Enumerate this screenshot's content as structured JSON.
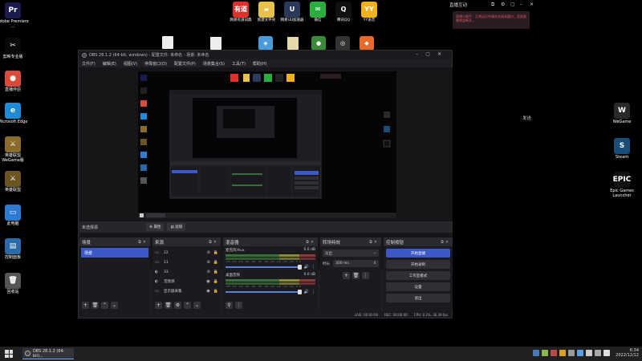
{
  "desktop_left": [
    {
      "label": "Adobe Premiere ...",
      "glyph": "Pr",
      "color": "#1c1b4e"
    },
    {
      "label": "剪映专业版",
      "glyph": "✂",
      "color": "#0a0a0a"
    },
    {
      "label": "直播伴侣",
      "glyph": "●",
      "color": "#d94a3a"
    },
    {
      "label": "Microsoft Edge",
      "glyph": "e",
      "color": "#1e8bd6"
    },
    {
      "label": "英雄联盟 WeGame版",
      "glyph": "⚔",
      "color": "#8a6b2b"
    },
    {
      "label": "英雄联盟",
      "glyph": "⚔",
      "color": "#6b5420"
    },
    {
      "label": "此电脑",
      "glyph": "▭",
      "color": "#2c7bd4"
    },
    {
      "label": "控制面板",
      "glyph": "▤",
      "color": "#2a6aa8"
    },
    {
      "label": "回收站",
      "glyph": "🗑",
      "color": "#555"
    }
  ],
  "desktop_top": [
    {
      "label": "网易有道词典",
      "glyph": "有道",
      "color": "#e0302c"
    },
    {
      "label": "新建文件夹",
      "glyph": "▰",
      "color": "#e8c04a"
    },
    {
      "label": "网易UU加速器",
      "glyph": "U",
      "color": "#2b3a5a"
    },
    {
      "label": "微信",
      "glyph": "✉",
      "color": "#2aae3e"
    },
    {
      "label": "腾讯QQ",
      "glyph": "Q",
      "color": "#111"
    },
    {
      "label": "YY语音",
      "glyph": "YY",
      "color": "#f0b020"
    }
  ],
  "desktop_right": [
    {
      "label": "WeGame",
      "glyph": "W",
      "color": "#2a2a2a"
    },
    {
      "label": "Steam",
      "glyph": "S",
      "color": "#1b4d7a"
    },
    {
      "label": "Epic Games Launcher",
      "glyph": "EPIC",
      "color": "#111"
    }
  ],
  "live_panel": {
    "title": "直播互动",
    "note": "直播小助手：正常运行中请勿关闭本窗口，否则直播将会断开...",
    "send": "发送"
  },
  "obs": {
    "title": "OBS 28.1.2 (64-bit, windows) - 配置文件: 未命名 - 场景: 未命名",
    "menu": [
      "文件(F)",
      "编辑(E)",
      "视图(V)",
      "停靠窗口(D)",
      "配置文件(P)",
      "场景集合(S)",
      "工具(T)",
      "帮助(H)"
    ],
    "source_bar": {
      "label": "未选择源",
      "props": "⚙ 属性",
      "filters": "▤ 滤镜"
    },
    "scenes": {
      "title": "场景",
      "items": [
        "场景"
      ]
    },
    "sources": {
      "title": "来源",
      "items": [
        {
          "icon": "▭",
          "name": "22",
          "state": "⊘"
        },
        {
          "icon": "▭",
          "name": "11",
          "state": "⊘"
        },
        {
          "icon": "◐",
          "name": "33",
          "state": "⊘"
        },
        {
          "icon": "◐",
          "name": "音频源",
          "state": "◉"
        },
        {
          "icon": "▭",
          "name": "显示器采集",
          "state": "◉"
        }
      ]
    },
    "mixer": {
      "title": "混音器",
      "channels": [
        {
          "name": "麦克风/Aux",
          "db": "0.0 dB"
        },
        {
          "name": "桌面音频",
          "db": "0.0 dB"
        }
      ],
      "ticks": "-60 -55 -50 -45 -40 -35 -30 -25 -20 -15 -10 -5 0"
    },
    "transitions": {
      "title": "转场特效",
      "type": "淡出",
      "duration_label": "时长",
      "duration": "300 ms"
    },
    "controls": {
      "title": "控制按钮",
      "buttons": [
        "开始直播",
        "开始录制",
        "工作室模式",
        "设置",
        "退出"
      ]
    },
    "status": {
      "live": "LIVE: 00:00:00",
      "rec": "REC: 00:00:00",
      "cpu": "CPU: 0.2%, 36.39 fps"
    }
  },
  "taskbar": {
    "app": "OBS 28.1.2 (64-bit)...",
    "time": "6:34",
    "date": "2022/12/12"
  }
}
